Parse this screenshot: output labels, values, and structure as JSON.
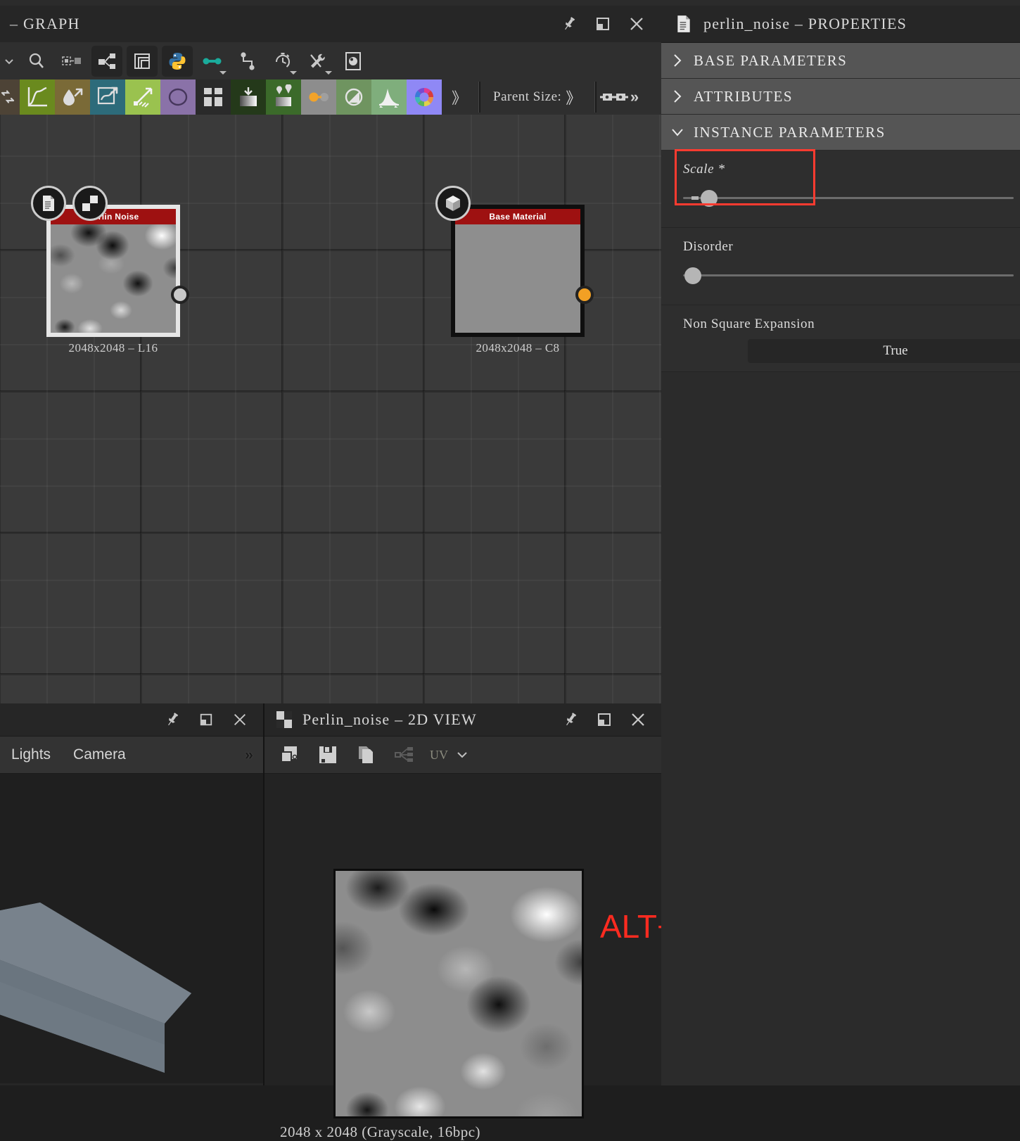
{
  "app": {
    "graph_panel": {
      "title": "GRAPH",
      "dash": "–",
      "window_buttons": [
        {
          "name": "pin-icon",
          "label": "Pin"
        },
        {
          "name": "maximize-icon",
          "label": "Maximize"
        },
        {
          "name": "close-icon",
          "label": "Close"
        }
      ],
      "toolbar_primary": [
        {
          "name": "chevron-down-icon",
          "label": "More",
          "active": false,
          "caret": false
        },
        {
          "name": "search-icon",
          "label": "Search",
          "active": false,
          "caret": false
        },
        {
          "name": "align-nodes-icon",
          "label": "Align Nodes",
          "active": false,
          "caret": false
        },
        {
          "name": "graph-hierarchy-icon",
          "label": "Graph Hierarchy",
          "active": true,
          "caret": false
        },
        {
          "name": "layers-icon",
          "label": "Layers",
          "active": true,
          "caret": false
        },
        {
          "name": "python-icon",
          "label": "Python Editor",
          "active": true,
          "caret": false
        },
        {
          "name": "link-nodes-icon",
          "label": "Link Nodes",
          "active": false,
          "caret": true
        },
        {
          "name": "connection-style-icon",
          "label": "Connection Style",
          "active": false,
          "caret": false
        },
        {
          "name": "timer-icon",
          "label": "Compute Timing",
          "active": false,
          "caret": true
        },
        {
          "name": "tools-icon",
          "label": "Tools",
          "active": false,
          "caret": true
        },
        {
          "name": "preview-icon",
          "label": "Preview Mode",
          "active": false,
          "caret": false
        }
      ],
      "node_library": [
        {
          "name": "swatch-atomic-icon",
          "label": "Atomic Nodes",
          "bg": "#5a4f3a",
          "fg": "#d3d3d3"
        },
        {
          "name": "swatch-curve-icon",
          "label": "Curve / Levels",
          "bg": "#6a8a1e",
          "fg": "#e8e8e8"
        },
        {
          "name": "swatch-blend-icon",
          "label": "Blending",
          "bg": "#7a6a37",
          "fg": "#dcdcdc"
        },
        {
          "name": "swatch-transform-icon",
          "label": "Transforms",
          "bg": "#2d6b7a",
          "fg": "#dcdcdc"
        },
        {
          "name": "swatch-gradient-icon",
          "label": "Gradient",
          "bg": "#9ac24f",
          "fg": "#f2f2f2"
        },
        {
          "name": "swatch-shape-icon",
          "label": "Pattern",
          "bg": "#8a72a8",
          "fg": "#3b2f4d"
        },
        {
          "name": "swatch-grid-icon",
          "label": "Tiling",
          "bg": "#2a2a2a",
          "fg": "#d2d2d2"
        },
        {
          "name": "swatch-fill-icon",
          "label": "Fill",
          "bg": "#24391a",
          "fg": "#e6e6e6"
        },
        {
          "name": "swatch-noise-icon",
          "label": "Noises",
          "bg": "#3b6a2a",
          "fg": "#e0e0e0"
        },
        {
          "name": "swatch-material-icon",
          "label": "Material Nodes",
          "bg": "#8d8d8d",
          "fg": "#f2a32a"
        },
        {
          "name": "swatch-filter-icon",
          "label": "Filters",
          "bg": "#6f9460",
          "fg": "#e4e4e4"
        },
        {
          "name": "swatch-histogram-icon",
          "label": "Adjustments",
          "bg": "#7fae7c",
          "fg": "#f0f0f0"
        },
        {
          "name": "swatch-colorwheel-icon",
          "label": "Color",
          "bg": "#8f88f5",
          "fg": "#ffffff"
        }
      ],
      "overflow_label": "》",
      "parent_size_label": "Parent Size:",
      "parent_size_chevron": "》",
      "link_toggle_name": "link-parent-size-icon",
      "right_overflow_label": "»"
    },
    "graph_nodes": [
      {
        "name": "node-perlin-noise",
        "title": "Perlin Noise",
        "caption": "2048x2048 – L16",
        "badges": [
          {
            "name": "document-icon",
            "label": "Instance"
          },
          {
            "name": "checker-icon",
            "label": "2D View"
          }
        ],
        "output_dot_color": "#c9c9c9",
        "selected": true
      },
      {
        "name": "node-base-material",
        "title": "Base Material",
        "caption": "2048x2048 – C8",
        "badges": [
          {
            "name": "cube-3d-icon",
            "label": "3D View"
          }
        ],
        "output_dot_color": "#f2a024",
        "selected": false
      }
    ],
    "view3d_panel": {
      "title": "",
      "window_buttons": [
        {
          "name": "pin-icon",
          "label": "Pin"
        },
        {
          "name": "maximize-icon",
          "label": "Maximize"
        },
        {
          "name": "close-icon",
          "label": "Close"
        }
      ],
      "tabs": [
        {
          "name": "tab-lights",
          "label": "Lights"
        },
        {
          "name": "tab-camera",
          "label": "Camera"
        }
      ],
      "overflow_label": "»"
    },
    "view2d_panel": {
      "icon_name": "checker-icon",
      "title": "Perlin_noise – 2D VIEW",
      "window_buttons": [
        {
          "name": "pin-icon",
          "label": "Pin"
        },
        {
          "name": "maximize-icon",
          "label": "Maximize"
        },
        {
          "name": "close-icon",
          "label": "Close"
        }
      ],
      "toolbar": [
        {
          "name": "compare-icon",
          "label": "Compare"
        },
        {
          "name": "save-icon",
          "label": "Save Image"
        },
        {
          "name": "copy-icon",
          "label": "Copy Image"
        },
        {
          "name": "channels-icon",
          "label": "Channels",
          "disabled": true
        },
        {
          "name": "uv-label",
          "label": "UV",
          "disabled": true
        },
        {
          "name": "chevron-down-icon",
          "label": "UV Options"
        }
      ],
      "status": "2048 x 2048 (Grayscale, 16bpc)"
    },
    "properties_panel": {
      "icon_name": "document-icon",
      "title": "perlin_noise – PROPERTIES",
      "sections": [
        {
          "name": "section-base-parameters",
          "label": "BASE PARAMETERS",
          "expanded": false,
          "chevron": "›"
        },
        {
          "name": "section-attributes",
          "label": "ATTRIBUTES",
          "expanded": false,
          "chevron": "›"
        },
        {
          "name": "section-instance-parameters",
          "label": "INSTANCE PARAMETERS",
          "expanded": true,
          "chevron": "⌄"
        }
      ],
      "parameters": [
        {
          "name": "param-scale",
          "label": "Scale *",
          "type": "slider",
          "italic": true,
          "highlighted": true,
          "knob_percent": 4,
          "has_minitick": true
        },
        {
          "name": "param-disorder",
          "label": "Disorder",
          "type": "slider",
          "italic": false,
          "highlighted": false,
          "knob_percent": 0,
          "has_minitick": false
        },
        {
          "name": "param-non-square-expansion",
          "label": "Non Square Expansion",
          "type": "dropdown",
          "italic": false,
          "highlighted": false,
          "value": "True"
        }
      ],
      "highlight_color": "#ff3b30"
    },
    "annotation": {
      "name": "annotation-alt-right-click",
      "text": "ALT+右键",
      "color": "#ff2b20"
    }
  }
}
